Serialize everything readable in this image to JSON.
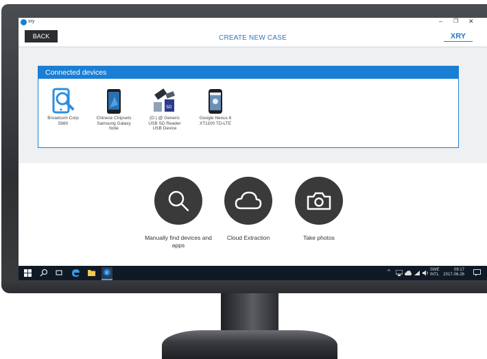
{
  "window": {
    "app_name": "xry",
    "min_glyph": "–",
    "max_glyph": "❐",
    "close_glyph": "✕"
  },
  "header": {
    "back_label": "BACK",
    "title": "CREATE NEW CASE",
    "brand": "XRY"
  },
  "connected_devices": {
    "title": "Connected devices",
    "devices": [
      {
        "label": "Broadcom Corp 5880",
        "icon": "fingerprint-scanner-icon"
      },
      {
        "label": "Chinese Chipsets Samsung Galaxy Note",
        "icon": "android-phone-icon"
      },
      {
        "label": "(D:) @ Generic USB SD Reader USB Device",
        "icon": "usb-sd-card-icon"
      },
      {
        "label": "Google Nexus 6 XT1100 TD-LTE",
        "icon": "android-phone-icon"
      }
    ]
  },
  "actions": [
    {
      "label": "Manually find devices and apps",
      "icon": "search-icon"
    },
    {
      "label": "Cloud Extraction",
      "icon": "cloud-icon"
    },
    {
      "label": "Take photos",
      "icon": "camera-icon"
    }
  ],
  "taskbar": {
    "language": "SWE",
    "layout": "INTL",
    "time": "09:17",
    "date": "2017-06-26"
  },
  "colors": {
    "accent": "#1a7fd4",
    "button_dark": "#2b2d30",
    "action_circle": "#3a3a3a",
    "taskbar": "#0f1a26"
  }
}
